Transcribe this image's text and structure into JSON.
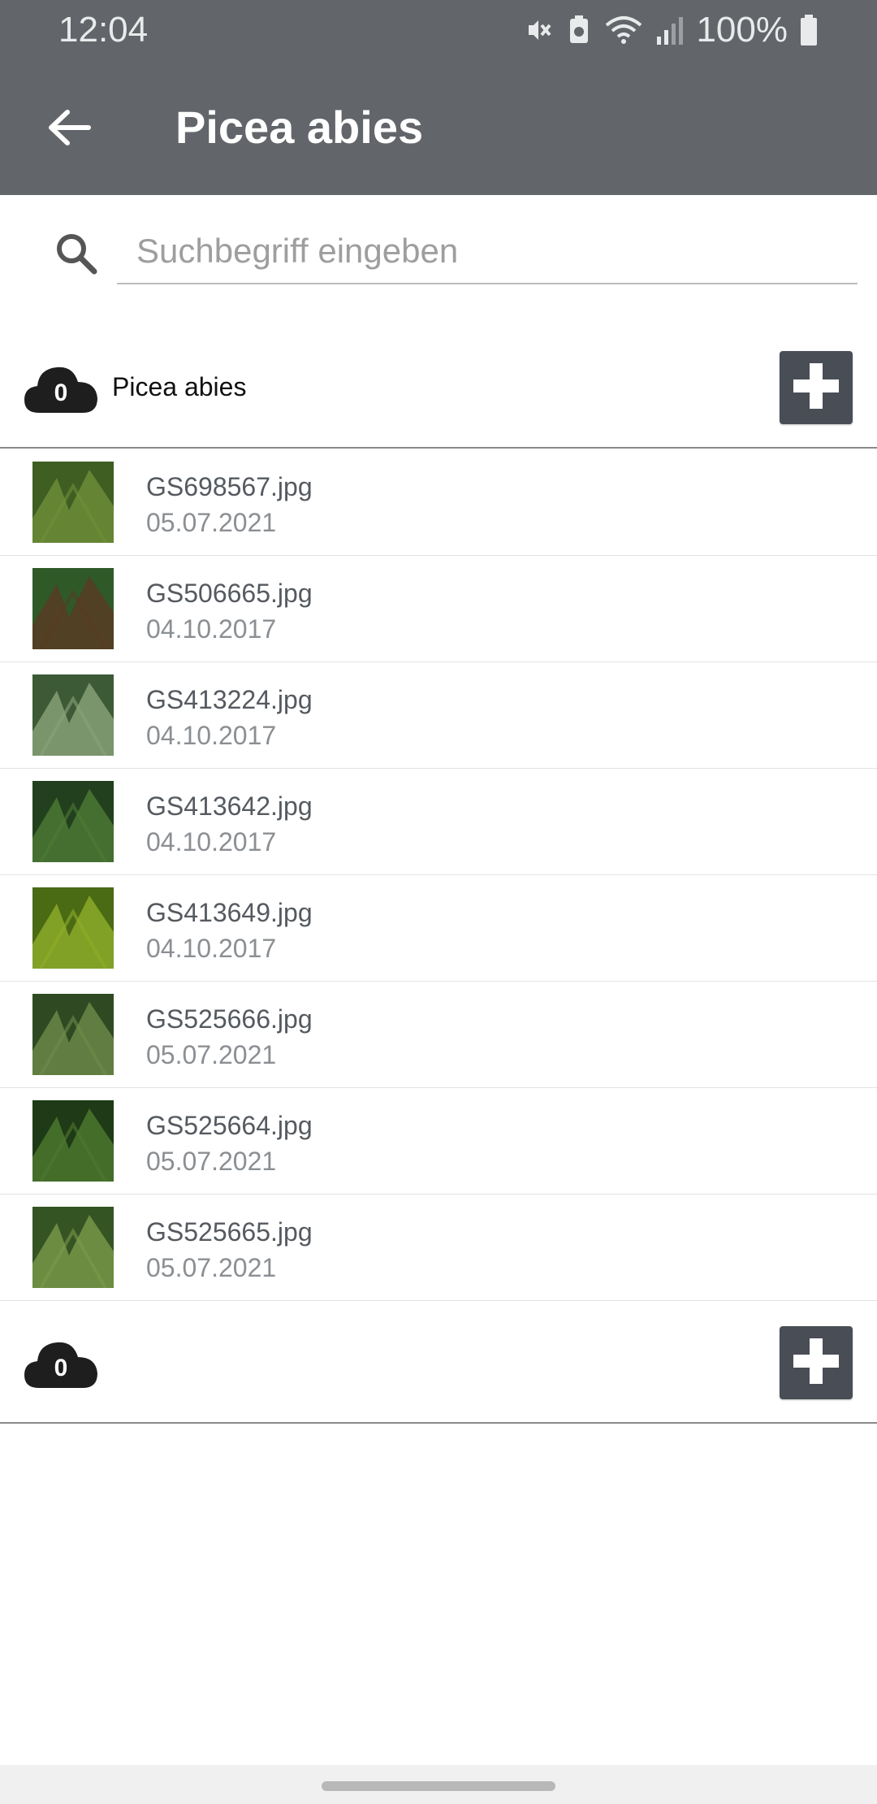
{
  "status_bar": {
    "time": "12:04",
    "battery_percent": "100%",
    "icons": [
      "mute-icon",
      "battery-saver-icon",
      "wifi-icon",
      "signal-icon",
      "battery-icon"
    ],
    "background": "#626569"
  },
  "app_bar": {
    "title": "Picea abies",
    "back_icon": "arrow-left-icon",
    "background": "#626569"
  },
  "search": {
    "placeholder": "Suchbegriff eingeben",
    "value": ""
  },
  "group_top": {
    "count": "0",
    "label": "Picea abies",
    "add_icon": "plus-icon"
  },
  "files": [
    {
      "name": "GS698567.jpg",
      "date": "05.07.2021",
      "thumb_colors": [
        "#6f8f3a",
        "#3f5e22"
      ]
    },
    {
      "name": "GS506665.jpg",
      "date": "04.10.2017",
      "thumb_colors": [
        "#5a3a22",
        "#2f5a28"
      ]
    },
    {
      "name": "GS413224.jpg",
      "date": "04.10.2017",
      "thumb_colors": [
        "#8aa27a",
        "#3c5a36"
      ]
    },
    {
      "name": "GS413642.jpg",
      "date": "04.10.2017",
      "thumb_colors": [
        "#4f7a36",
        "#22401d"
      ]
    },
    {
      "name": "GS413649.jpg",
      "date": "04.10.2017",
      "thumb_colors": [
        "#8fae2a",
        "#4a6a14"
      ]
    },
    {
      "name": "GS525666.jpg",
      "date": "05.07.2021",
      "thumb_colors": [
        "#6f8a4a",
        "#2f4a22"
      ]
    },
    {
      "name": "GS525664.jpg",
      "date": "05.07.2021",
      "thumb_colors": [
        "#4e7a30",
        "#1f3a16"
      ]
    },
    {
      "name": "GS525665.jpg",
      "date": "05.07.2021",
      "thumb_colors": [
        "#7a9a4a",
        "#355424"
      ]
    }
  ],
  "group_bottom": {
    "count": "0",
    "add_icon": "plus-icon"
  },
  "colors": {
    "add_button": "#494d55",
    "cloud": "#1e1e1e"
  }
}
